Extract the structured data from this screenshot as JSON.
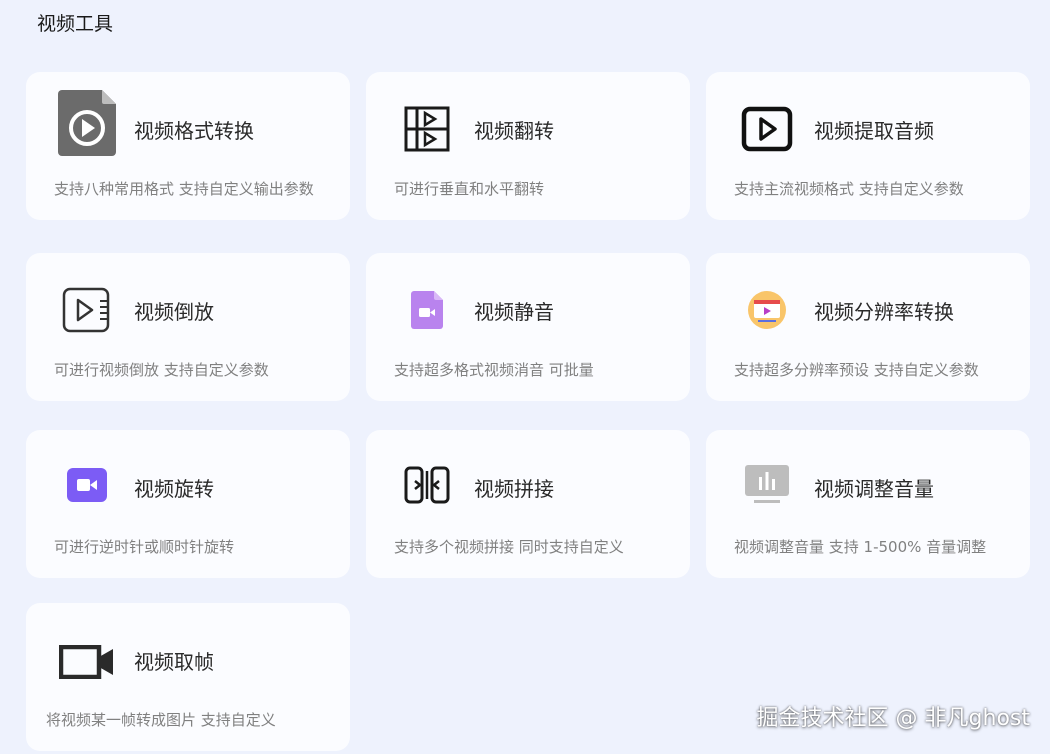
{
  "page": {
    "title": "视频工具"
  },
  "cards": [
    {
      "title": "视频格式转换",
      "desc": "支持八种常用格式 支持自定义输出参数",
      "icon": "video-file-icon"
    },
    {
      "title": "视频翻转",
      "desc": "可进行垂直和水平翻转",
      "icon": "flip-icon"
    },
    {
      "title": "视频提取音频",
      "desc": "支持主流视频格式 支持自定义参数",
      "icon": "play-box-icon"
    },
    {
      "title": "视频倒放",
      "desc": "可进行视频倒放 支持自定义参数",
      "icon": "reverse-play-icon"
    },
    {
      "title": "视频静音",
      "desc": "支持超多格式视频消音 可批量",
      "icon": "purple-video-file-icon"
    },
    {
      "title": "视频分辨率转换",
      "desc": "支持超多分辨率预设 支持自定义参数",
      "icon": "resolution-monitor-icon"
    },
    {
      "title": "视频旋转",
      "desc": "可进行逆时针或顺时针旋转",
      "icon": "camera-icon"
    },
    {
      "title": "视频拼接",
      "desc": "支持多个视频拼接 同时支持自定义",
      "icon": "splice-icon"
    },
    {
      "title": "视频调整音量",
      "desc": "视频调整音量 支持 1-500% 音量调整",
      "icon": "volume-bars-icon"
    },
    {
      "title": "视频取帧",
      "desc": "将视频某一帧转成图片  支持自定义",
      "icon": "video-camera-icon"
    }
  ],
  "watermark": "掘金技术社区 @ 非凡ghost",
  "colors": {
    "background": "#eef2fd",
    "card": "#fbfcff",
    "purple": "#7c5cf5",
    "lilac": "#b983ee"
  }
}
